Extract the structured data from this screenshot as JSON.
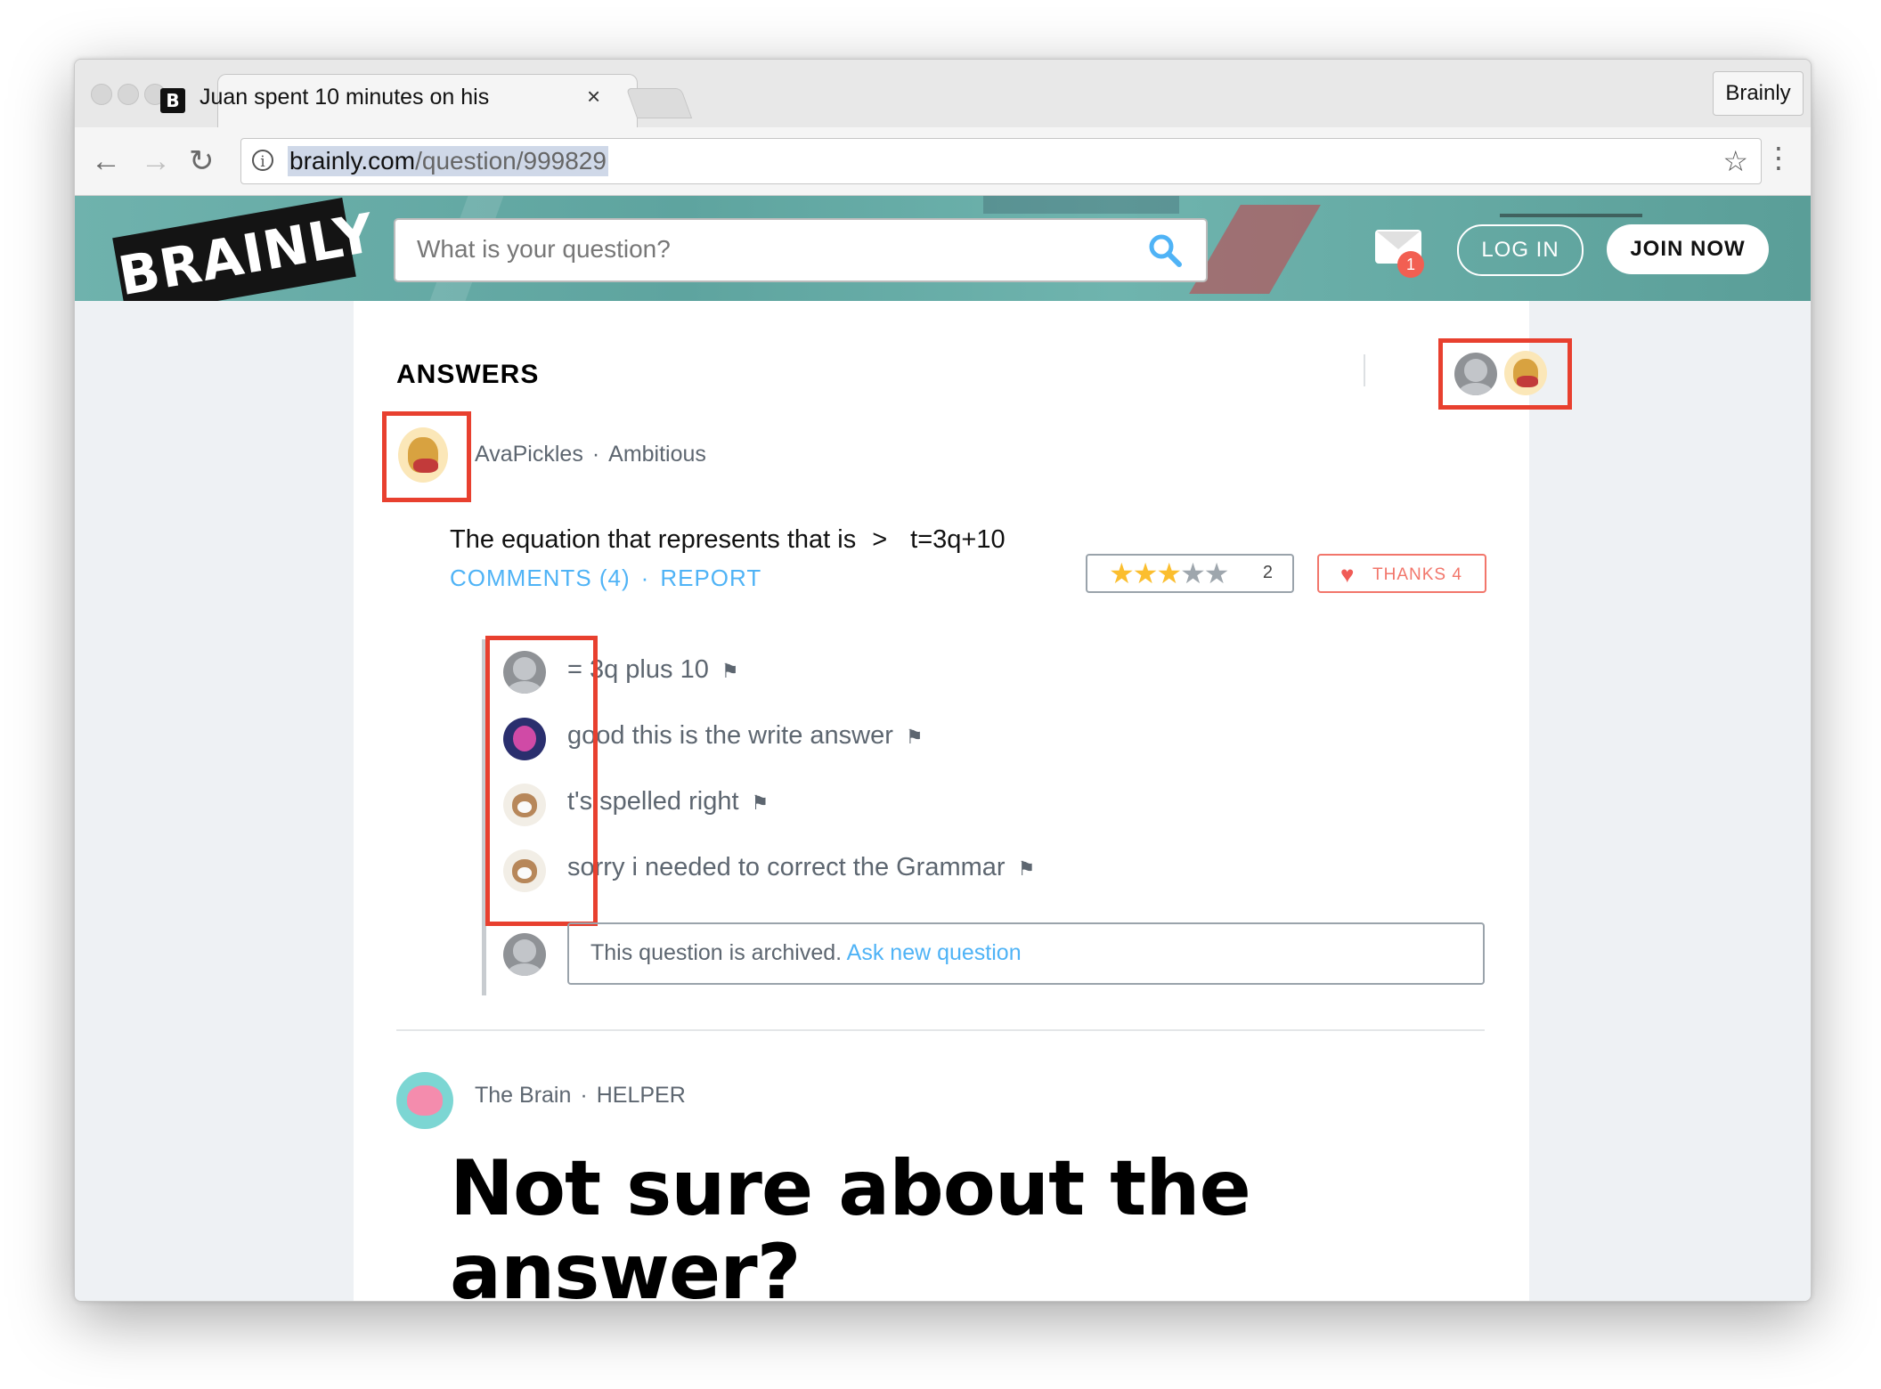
{
  "browser": {
    "tab_title": "Juan spent 10 minutes on his",
    "tab_favicon": "B",
    "tab_close": "×",
    "profile_label": "Brainly",
    "url_host": "brainly.com",
    "url_path": "/question/999829",
    "nav": {
      "back": "←",
      "forward": "→",
      "reload": "↻"
    },
    "icons": {
      "star": "☆",
      "menu": "⋮",
      "info": "i"
    }
  },
  "header": {
    "logo_text": "BRAINLY",
    "search_placeholder": "What is your question?",
    "mail_badge": "1",
    "login_label": "LOG IN",
    "join_label": "JOIN NOW"
  },
  "answers": {
    "heading": "ANSWERS",
    "answer": {
      "author": "AvaPickles",
      "rank": "Ambitious",
      "separator": "·",
      "text_prefix": "The equation that represents that is",
      "text_arrow": ">",
      "text_equation": "t=3q+10",
      "comments_link": "COMMENTS (4)",
      "report_link": "REPORT",
      "rating_stars": 3,
      "rating_count": "2",
      "thanks_label": "THANKS 4"
    },
    "comments": [
      {
        "text": "= 3q plus 10",
        "avatar": "default-avatar"
      },
      {
        "text": "good this is the write answer",
        "avatar": "space-avatar"
      },
      {
        "text": "t's spelled right",
        "avatar": "dog-avatar"
      },
      {
        "text": "sorry i needed to correct the Grammar",
        "avatar": "dog-avatar"
      }
    ],
    "archived_text": "This question is archived.",
    "archived_link": "Ask new question"
  },
  "helper": {
    "name": "The Brain",
    "role": "HELPER",
    "title": "Not sure about the answer?"
  },
  "colors": {
    "accent_blue": "#4fb3f6",
    "highlight_red": "#e8402f",
    "thanks_red": "#f2766b",
    "star_yellow": "#fbbe2e",
    "banner_teal": "#6fb2ad"
  }
}
